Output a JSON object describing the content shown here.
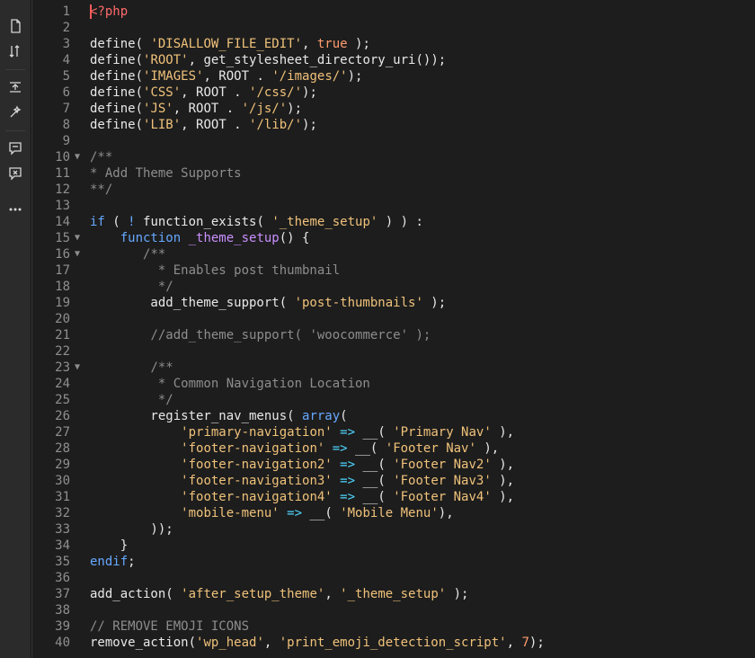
{
  "toolbar": {
    "tools": [
      "file-icon",
      "sort-icon",
      "indent-icon",
      "wand-icon",
      "comment-icon",
      "uncomment-icon",
      "more-icon"
    ]
  },
  "colors": {
    "background": "#1d1d1d",
    "gutter_text": "#8f8f8f",
    "plain": "#e8e8e8",
    "keyword": "#66a8ff",
    "function": "#c990ff",
    "string": "#f0c27a",
    "comment": "#8d8d8d",
    "tag": "#ff6a6a",
    "number": "#ff9c6e",
    "operator": "#4fd6ff"
  },
  "code": {
    "lines": [
      {
        "num": "1",
        "fold": false,
        "tokens": [
          {
            "t": "<?php",
            "c": "tag"
          }
        ]
      },
      {
        "num": "2",
        "fold": false,
        "tokens": []
      },
      {
        "num": "3",
        "fold": false,
        "tokens": [
          {
            "t": "define( ",
            "c": "plain"
          },
          {
            "t": "'DISALLOW_FILE_EDIT'",
            "c": "string"
          },
          {
            "t": ", ",
            "c": "plain"
          },
          {
            "t": "true",
            "c": "const"
          },
          {
            "t": " );",
            "c": "plain"
          }
        ]
      },
      {
        "num": "4",
        "fold": false,
        "tokens": [
          {
            "t": "define(",
            "c": "plain"
          },
          {
            "t": "'ROOT'",
            "c": "string"
          },
          {
            "t": ", get_stylesheet_directory_uri());",
            "c": "plain"
          }
        ]
      },
      {
        "num": "5",
        "fold": false,
        "tokens": [
          {
            "t": "define(",
            "c": "plain"
          },
          {
            "t": "'IMAGES'",
            "c": "string"
          },
          {
            "t": ", ROOT . ",
            "c": "plain"
          },
          {
            "t": "'/images/'",
            "c": "string"
          },
          {
            "t": ");",
            "c": "plain"
          }
        ]
      },
      {
        "num": "6",
        "fold": false,
        "tokens": [
          {
            "t": "define(",
            "c": "plain"
          },
          {
            "t": "'CSS'",
            "c": "string"
          },
          {
            "t": ", ROOT . ",
            "c": "plain"
          },
          {
            "t": "'/css/'",
            "c": "string"
          },
          {
            "t": ");",
            "c": "plain"
          }
        ]
      },
      {
        "num": "7",
        "fold": false,
        "tokens": [
          {
            "t": "define(",
            "c": "plain"
          },
          {
            "t": "'JS'",
            "c": "string"
          },
          {
            "t": ", ROOT . ",
            "c": "plain"
          },
          {
            "t": "'/js/'",
            "c": "string"
          },
          {
            "t": ");",
            "c": "plain"
          }
        ]
      },
      {
        "num": "8",
        "fold": false,
        "tokens": [
          {
            "t": "define(",
            "c": "plain"
          },
          {
            "t": "'LIB'",
            "c": "string"
          },
          {
            "t": ", ROOT . ",
            "c": "plain"
          },
          {
            "t": "'/lib/'",
            "c": "string"
          },
          {
            "t": ");",
            "c": "plain"
          }
        ]
      },
      {
        "num": "9",
        "fold": false,
        "tokens": []
      },
      {
        "num": "10",
        "fold": true,
        "tokens": [
          {
            "t": "/**",
            "c": "comment"
          }
        ]
      },
      {
        "num": "11",
        "fold": false,
        "tokens": [
          {
            "t": "* Add Theme Supports",
            "c": "comment"
          }
        ]
      },
      {
        "num": "12",
        "fold": false,
        "tokens": [
          {
            "t": "**/",
            "c": "comment"
          }
        ]
      },
      {
        "num": "13",
        "fold": false,
        "tokens": []
      },
      {
        "num": "14",
        "fold": false,
        "tokens": [
          {
            "t": "if",
            "c": "keyword"
          },
          {
            "t": " ( ",
            "c": "plain"
          },
          {
            "t": "!",
            "c": "keyword"
          },
          {
            "t": " function_exists( ",
            "c": "plain"
          },
          {
            "t": "'_theme_setup'",
            "c": "string"
          },
          {
            "t": " ) ) :",
            "c": "plain"
          }
        ]
      },
      {
        "num": "15",
        "fold": true,
        "tokens": [
          {
            "t": "    ",
            "c": "plain"
          },
          {
            "t": "function",
            "c": "keyword"
          },
          {
            "t": " ",
            "c": "plain"
          },
          {
            "t": "_theme_setup",
            "c": "fn"
          },
          {
            "t": "() {",
            "c": "plain"
          }
        ]
      },
      {
        "num": "16",
        "fold": true,
        "tokens": [
          {
            "t": "       ",
            "c": "plain"
          },
          {
            "t": "/**",
            "c": "comment"
          }
        ]
      },
      {
        "num": "17",
        "fold": false,
        "tokens": [
          {
            "t": "         ",
            "c": "plain"
          },
          {
            "t": "* Enables post thumbnail",
            "c": "comment"
          }
        ]
      },
      {
        "num": "18",
        "fold": false,
        "tokens": [
          {
            "t": "         ",
            "c": "plain"
          },
          {
            "t": "*/",
            "c": "comment"
          }
        ]
      },
      {
        "num": "19",
        "fold": false,
        "tokens": [
          {
            "t": "        add_theme_support( ",
            "c": "plain"
          },
          {
            "t": "'post-thumbnails'",
            "c": "string"
          },
          {
            "t": " );",
            "c": "plain"
          }
        ]
      },
      {
        "num": "20",
        "fold": false,
        "tokens": []
      },
      {
        "num": "21",
        "fold": false,
        "tokens": [
          {
            "t": "        ",
            "c": "plain"
          },
          {
            "t": "//add_theme_support( 'woocommerce' );",
            "c": "comment"
          }
        ]
      },
      {
        "num": "22",
        "fold": false,
        "tokens": []
      },
      {
        "num": "23",
        "fold": true,
        "tokens": [
          {
            "t": "        ",
            "c": "plain"
          },
          {
            "t": "/**",
            "c": "comment"
          }
        ]
      },
      {
        "num": "24",
        "fold": false,
        "tokens": [
          {
            "t": "         ",
            "c": "plain"
          },
          {
            "t": "* Common Navigation Location",
            "c": "comment"
          }
        ]
      },
      {
        "num": "25",
        "fold": false,
        "tokens": [
          {
            "t": "         ",
            "c": "plain"
          },
          {
            "t": "*/",
            "c": "comment"
          }
        ]
      },
      {
        "num": "26",
        "fold": false,
        "tokens": [
          {
            "t": "        register_nav_menus( ",
            "c": "plain"
          },
          {
            "t": "array",
            "c": "keyword"
          },
          {
            "t": "(",
            "c": "plain"
          }
        ]
      },
      {
        "num": "27",
        "fold": false,
        "tokens": [
          {
            "t": "            ",
            "c": "plain"
          },
          {
            "t": "'primary-navigation'",
            "c": "string"
          },
          {
            "t": " ",
            "c": "plain"
          },
          {
            "t": "=>",
            "c": "operator"
          },
          {
            "t": " __( ",
            "c": "plain"
          },
          {
            "t": "'Primary Nav'",
            "c": "string"
          },
          {
            "t": " ),",
            "c": "plain"
          }
        ]
      },
      {
        "num": "28",
        "fold": false,
        "tokens": [
          {
            "t": "            ",
            "c": "plain"
          },
          {
            "t": "'footer-navigation'",
            "c": "string"
          },
          {
            "t": " ",
            "c": "plain"
          },
          {
            "t": "=>",
            "c": "operator"
          },
          {
            "t": " __( ",
            "c": "plain"
          },
          {
            "t": "'Footer Nav'",
            "c": "string"
          },
          {
            "t": " ),",
            "c": "plain"
          }
        ]
      },
      {
        "num": "29",
        "fold": false,
        "tokens": [
          {
            "t": "            ",
            "c": "plain"
          },
          {
            "t": "'footer-navigation2'",
            "c": "string"
          },
          {
            "t": " ",
            "c": "plain"
          },
          {
            "t": "=>",
            "c": "operator"
          },
          {
            "t": " __( ",
            "c": "plain"
          },
          {
            "t": "'Footer Nav2'",
            "c": "string"
          },
          {
            "t": " ),",
            "c": "plain"
          }
        ]
      },
      {
        "num": "30",
        "fold": false,
        "tokens": [
          {
            "t": "            ",
            "c": "plain"
          },
          {
            "t": "'footer-navigation3'",
            "c": "string"
          },
          {
            "t": " ",
            "c": "plain"
          },
          {
            "t": "=>",
            "c": "operator"
          },
          {
            "t": " __( ",
            "c": "plain"
          },
          {
            "t": "'Footer Nav3'",
            "c": "string"
          },
          {
            "t": " ),",
            "c": "plain"
          }
        ]
      },
      {
        "num": "31",
        "fold": false,
        "tokens": [
          {
            "t": "            ",
            "c": "plain"
          },
          {
            "t": "'footer-navigation4'",
            "c": "string"
          },
          {
            "t": " ",
            "c": "plain"
          },
          {
            "t": "=>",
            "c": "operator"
          },
          {
            "t": " __( ",
            "c": "plain"
          },
          {
            "t": "'Footer Nav4'",
            "c": "string"
          },
          {
            "t": " ),",
            "c": "plain"
          }
        ]
      },
      {
        "num": "32",
        "fold": false,
        "tokens": [
          {
            "t": "            ",
            "c": "plain"
          },
          {
            "t": "'mobile-menu'",
            "c": "string"
          },
          {
            "t": " ",
            "c": "plain"
          },
          {
            "t": "=>",
            "c": "operator"
          },
          {
            "t": " __( ",
            "c": "plain"
          },
          {
            "t": "'Mobile Menu'",
            "c": "string"
          },
          {
            "t": "),",
            "c": "plain"
          }
        ]
      },
      {
        "num": "33",
        "fold": false,
        "tokens": [
          {
            "t": "        ));",
            "c": "plain"
          }
        ]
      },
      {
        "num": "34",
        "fold": false,
        "tokens": [
          {
            "t": "    }",
            "c": "plain"
          }
        ]
      },
      {
        "num": "35",
        "fold": false,
        "tokens": [
          {
            "t": "endif",
            "c": "keyword"
          },
          {
            "t": ";",
            "c": "plain"
          }
        ]
      },
      {
        "num": "36",
        "fold": false,
        "tokens": []
      },
      {
        "num": "37",
        "fold": false,
        "tokens": [
          {
            "t": "add_action( ",
            "c": "plain"
          },
          {
            "t": "'after_setup_theme'",
            "c": "string"
          },
          {
            "t": ", ",
            "c": "plain"
          },
          {
            "t": "'_theme_setup'",
            "c": "string"
          },
          {
            "t": " );",
            "c": "plain"
          }
        ]
      },
      {
        "num": "38",
        "fold": false,
        "tokens": []
      },
      {
        "num": "39",
        "fold": false,
        "tokens": [
          {
            "t": "// REMOVE EMOJI ICONS",
            "c": "comment"
          }
        ]
      },
      {
        "num": "40",
        "fold": false,
        "tokens": [
          {
            "t": "remove_action(",
            "c": "plain"
          },
          {
            "t": "'wp_head'",
            "c": "string"
          },
          {
            "t": ", ",
            "c": "plain"
          },
          {
            "t": "'print_emoji_detection_script'",
            "c": "string"
          },
          {
            "t": ", ",
            "c": "plain"
          },
          {
            "t": "7",
            "c": "const"
          },
          {
            "t": ");",
            "c": "plain"
          }
        ]
      }
    ]
  }
}
